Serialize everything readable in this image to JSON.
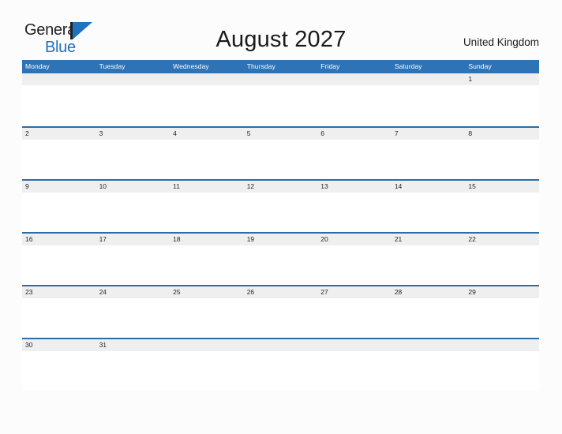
{
  "logo": {
    "word_top": "General",
    "word_bottom": "Blue",
    "flag_icon": "blue-flag-icon",
    "accent_color": "#1f72bd",
    "text_color": "#231f20"
  },
  "header": {
    "title": "August 2027",
    "region": "United Kingdom"
  },
  "calendar": {
    "month": "August",
    "year": "2027",
    "week_start": "Monday",
    "header_bg_color": "#2e73b5",
    "header_text_color": "#ffffff",
    "row_separator_color": "#2e6da4",
    "date_strip_color": "#efefef",
    "day_headers": [
      "Monday",
      "Tuesday",
      "Wednesday",
      "Thursday",
      "Friday",
      "Saturday",
      "Sunday"
    ],
    "weeks": [
      {
        "days": [
          "",
          "",
          "",
          "",
          "",
          "",
          "1"
        ]
      },
      {
        "days": [
          "2",
          "3",
          "4",
          "5",
          "6",
          "7",
          "8"
        ]
      },
      {
        "days": [
          "9",
          "10",
          "11",
          "12",
          "13",
          "14",
          "15"
        ]
      },
      {
        "days": [
          "16",
          "17",
          "18",
          "19",
          "20",
          "21",
          "22"
        ]
      },
      {
        "days": [
          "23",
          "24",
          "25",
          "26",
          "27",
          "28",
          "29"
        ]
      },
      {
        "days": [
          "30",
          "31",
          "",
          "",
          "",
          "",
          ""
        ]
      }
    ]
  }
}
